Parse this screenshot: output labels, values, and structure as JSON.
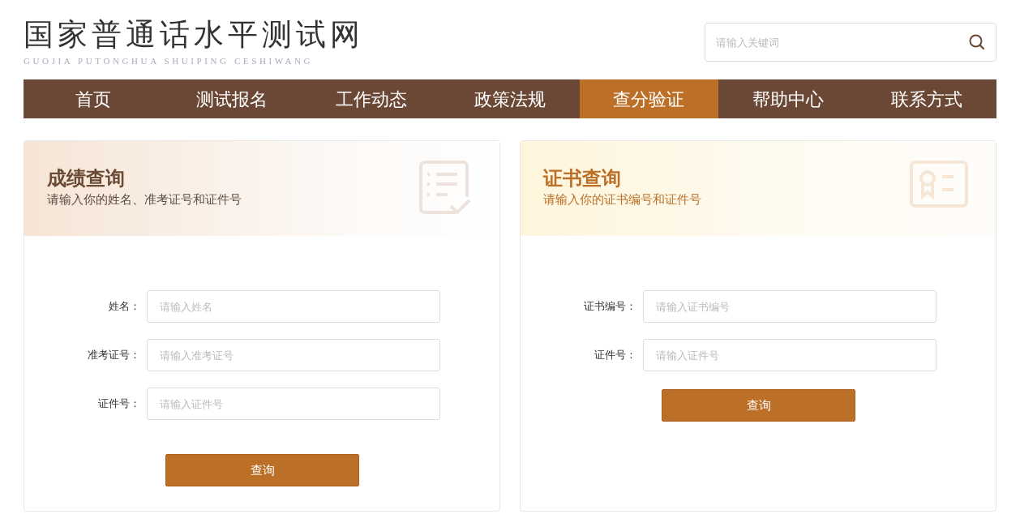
{
  "logo": {
    "title": "国家普通话水平测试网",
    "subtitle": "GUOJIA PUTONGHUA SHUIPING CESHIWANG"
  },
  "search": {
    "placeholder": "请输入关键词"
  },
  "nav": [
    {
      "label": "首页",
      "selected": false
    },
    {
      "label": "测试报名",
      "selected": false
    },
    {
      "label": "工作动态",
      "selected": false
    },
    {
      "label": "政策法规",
      "selected": false
    },
    {
      "label": "查分验证",
      "selected": true
    },
    {
      "label": "帮助中心",
      "selected": false
    },
    {
      "label": "联系方式",
      "selected": false
    }
  ],
  "panels": [
    {
      "kind": "score",
      "title": "成绩查询",
      "subtitle": "请输入你的姓名、准考证号和证件号",
      "fields": [
        {
          "label": "姓名：",
          "placeholder": "请输入姓名"
        },
        {
          "label": "准考证号：",
          "placeholder": "请输入准考证号"
        },
        {
          "label": "证件号：",
          "placeholder": "请输入证件号"
        }
      ],
      "button": "查询"
    },
    {
      "kind": "certificate",
      "title": "证书查询",
      "subtitle": "请输入你的证书编号和证件号",
      "fields": [
        {
          "label": "证书编号：",
          "placeholder": "请输入证书编号"
        },
        {
          "label": "证件号：",
          "placeholder": "请输入证件号"
        }
      ],
      "button": "查询"
    }
  ]
}
